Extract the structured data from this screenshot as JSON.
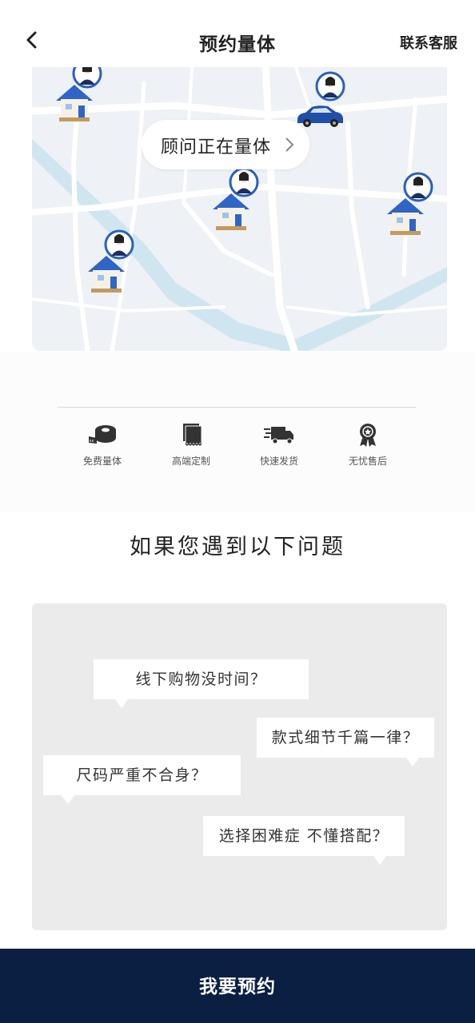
{
  "header": {
    "title": "预约量体",
    "service_label": "联系客服",
    "back_icon": "chevron-left-icon"
  },
  "map": {
    "status_text": "顾问正在量体",
    "status_icon": "chevron-right-icon",
    "road_color": "#ffffff",
    "block_color": "#eef1f5",
    "river_color": "#cde6f0",
    "pins": [
      {
        "icon": "house-with-advisor-icon"
      },
      {
        "icon": "house-with-advisor-icon"
      },
      {
        "icon": "house-with-advisor-icon"
      },
      {
        "icon": "house-with-advisor-icon"
      }
    ],
    "vehicle": {
      "icon": "car-with-advisor-icon",
      "color": "#1f4fa8"
    }
  },
  "features": [
    {
      "label": "免费量体",
      "icon": "tape-measure-icon"
    },
    {
      "label": "高端定制",
      "icon": "fabric-swatch-icon"
    },
    {
      "label": "快速发货",
      "icon": "delivery-truck-icon"
    },
    {
      "label": "无忧售后",
      "icon": "award-ribbon-icon"
    }
  ],
  "problems": {
    "title": "如果您遇到以下问题",
    "items": [
      "线下购物没时间？",
      "款式细节千篇一律？",
      "尺码严重不合身？",
      "选择困难症 不懂搭配？"
    ]
  },
  "cta": {
    "label": "我要预约",
    "color": "#0b1f43"
  }
}
